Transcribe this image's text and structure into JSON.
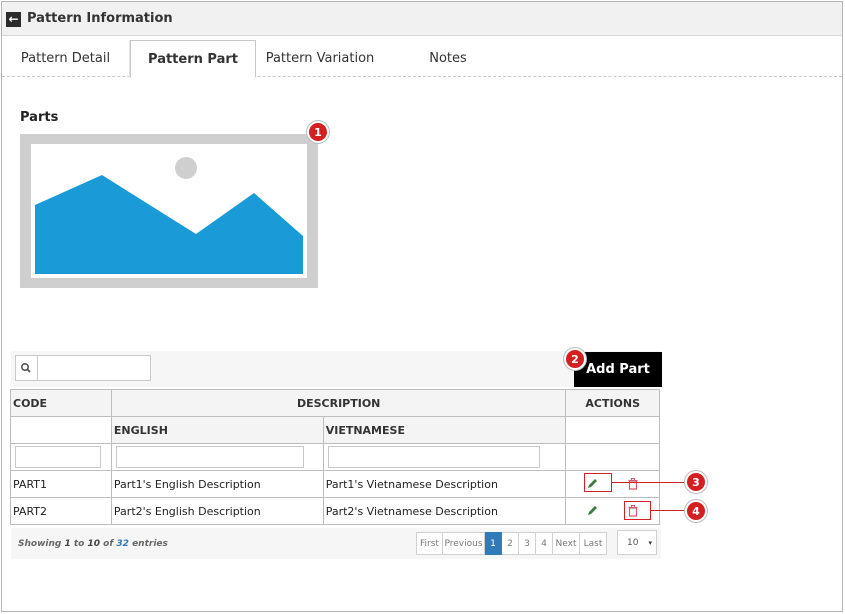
{
  "header": {
    "title": "Pattern Information",
    "back_glyph": "←"
  },
  "tabs": [
    {
      "label": "Pattern Detail"
    },
    {
      "label": "Pattern Part"
    },
    {
      "label": "Pattern Variation"
    },
    {
      "label": "Notes"
    }
  ],
  "parts": {
    "label": "Parts"
  },
  "badges": [
    "1",
    "2",
    "3",
    "4"
  ],
  "toolbar": {
    "search_placeholder": "",
    "add_label": "Add Part"
  },
  "table": {
    "headers": {
      "code": "CODE",
      "description": "DESCRIPTION",
      "actions": "ACTIONS",
      "english": "ENGLISH",
      "vietnamese": "VIETNAMESE"
    },
    "rows": [
      {
        "code": "PART1",
        "english": "Part1's English Description",
        "vietnamese": "Part1's Vietnamese Description"
      },
      {
        "code": "PART2",
        "english": "Part2's English Description",
        "vietnamese": "Part2's Vietnamese Description"
      }
    ]
  },
  "footer": {
    "info_prefix": "Showing ",
    "from": "1",
    "to_word": " to ",
    "to": "10",
    "of_word": " of ",
    "total": "32",
    "entries_word": " entries",
    "pager": [
      "First",
      "Previous",
      "1",
      "2",
      "3",
      "4",
      "Next",
      "Last"
    ],
    "page_size": "10",
    "caret": "▾"
  },
  "colors": {
    "accent": "#2f7ab8",
    "callout": "#d32020",
    "image_blue": "#1a9ad6",
    "image_gray": "#cfcfcf"
  },
  "icons": {
    "edit": "pencil-icon",
    "delete": "trash-icon",
    "search": "search-icon",
    "back": "back-arrow-icon"
  }
}
